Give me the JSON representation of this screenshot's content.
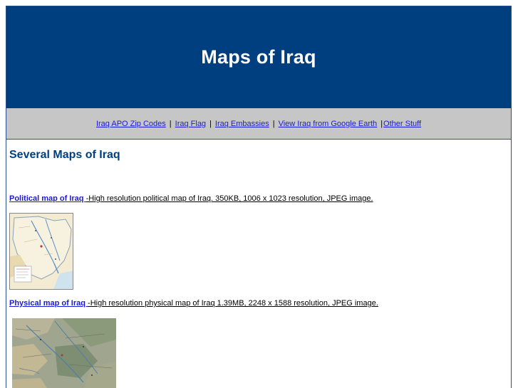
{
  "header": {
    "title": "Maps of Iraq"
  },
  "nav": {
    "items": [
      {
        "label": "Iraq APO Zip Codes "
      },
      {
        "label": "Iraq Flag "
      },
      {
        "label": "Iraq Embassies"
      },
      {
        "label": "View Iraq from Google Earth "
      },
      {
        "label": "Other Stuff"
      }
    ],
    "separator": "|"
  },
  "main": {
    "section_title": "Several Maps of Iraq",
    "maps": [
      {
        "link_label": "Political map of Iraq ",
        "description": "-High resolution political map of Iraq. 350KB, 1006 x 1023 resolution, JPEG image.",
        "thumbnail_icon": "political-map-thumbnail"
      },
      {
        "link_label": "Physical map of Iraq ",
        "description": "-High resolution physical map of Iraq 1.39MB, 2248 x 1588 resolution, JPEG image.",
        "thumbnail_icon": "physical-map-thumbnail"
      }
    ]
  },
  "colors": {
    "header_bg": "#003f7f",
    "nav_bg": "#c6c6c6",
    "link": "#1a1ad6",
    "heading": "#003f7f"
  }
}
